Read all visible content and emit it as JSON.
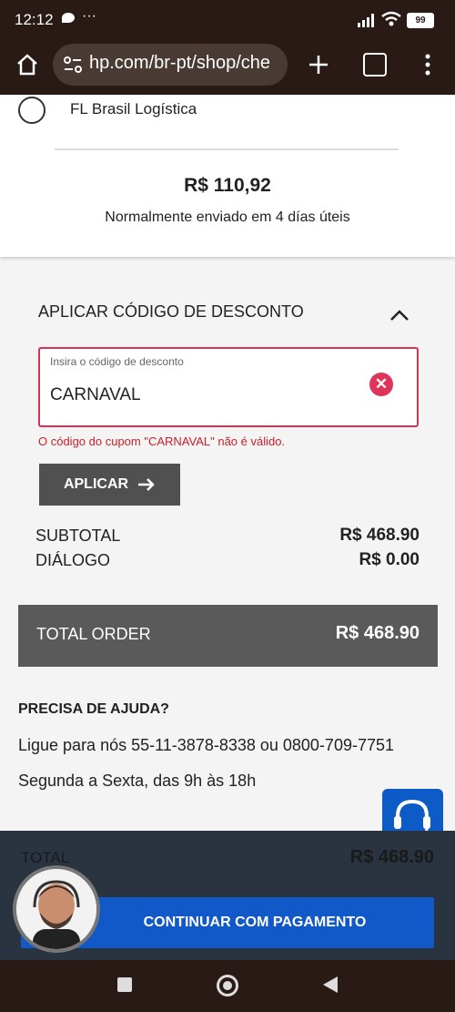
{
  "status_bar": {
    "time": "12:12",
    "dots": "···",
    "battery": "99"
  },
  "browser": {
    "url": "hp.com/br-pt/shop/che",
    "tab_count": ":D"
  },
  "shipping": {
    "option_label": "FL Brasil Logística",
    "price": "R$ 110,92",
    "note": "Normalmente enviado em 4 días úteis"
  },
  "discount": {
    "title": "APLICAR CÓDIGO DE DESCONTO",
    "field_label": "Insira o código de desconto",
    "field_value": "CARNAVAL",
    "error": "O código do cupom \"CARNAVAL\" não é válido.",
    "apply_label": "APLICAR"
  },
  "summary": {
    "subtotal_label": "SUBTOTAL",
    "subtotal_value": "R$ 468.90",
    "dialog_label": "DIÁLOGO",
    "dialog_value": "R$ 0.00",
    "total_label": "TOTAL ORDER",
    "total_value": "R$ 468.90"
  },
  "help": {
    "title": "PRECISA DE AJUDA?",
    "phone_line": "Ligue para nós 55-11-3878-8338 ou 0800-709-7751",
    "hours_line": "Segunda a Sexta, das 9h às 18h"
  },
  "bottom": {
    "total_label": "TOTAL",
    "total_value": "R$ 468.90",
    "pay_label": "CONTINUAR COM PAGAMENTO"
  },
  "colors": {
    "accent_blue": "#1158c9",
    "error_red": "#c8202a"
  }
}
